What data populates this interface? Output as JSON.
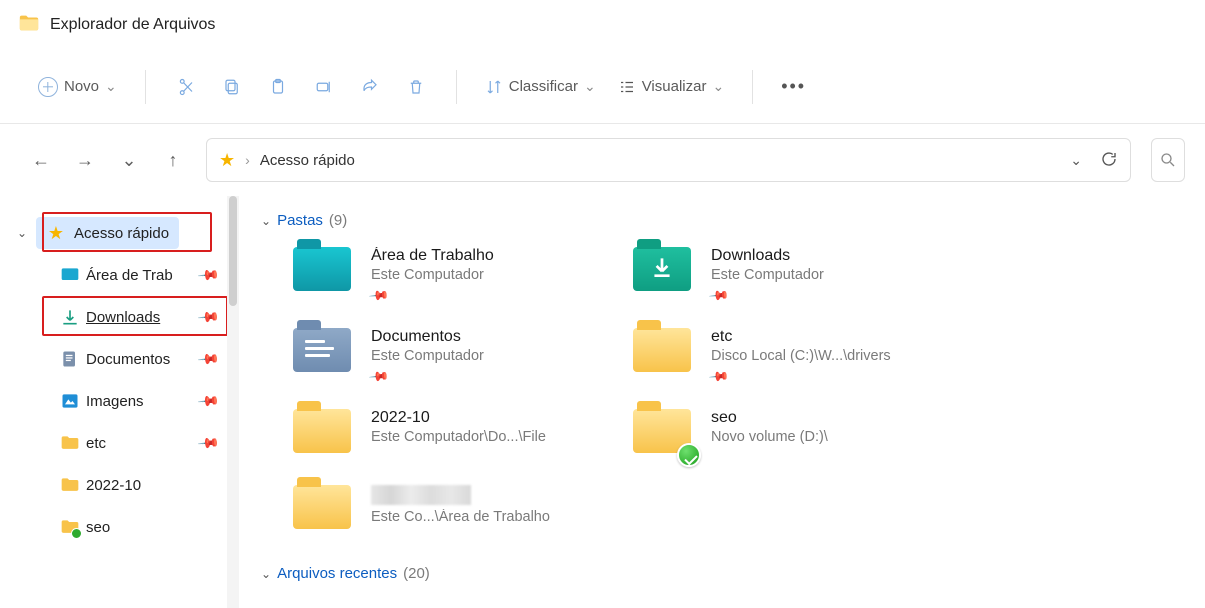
{
  "window": {
    "title": "Explorador de Arquivos"
  },
  "toolbar": {
    "new_label": "Novo",
    "sort_label": "Classificar",
    "view_label": "Visualizar"
  },
  "address": {
    "location": "Acesso rápido"
  },
  "sidebar": {
    "quick_access_label": "Acesso rápido",
    "items": [
      {
        "label": "Área de Trab"
      },
      {
        "label": "Downloads"
      },
      {
        "label": "Documentos"
      },
      {
        "label": "Imagens"
      },
      {
        "label": "etc"
      },
      {
        "label": "2022-10"
      },
      {
        "label": "seo"
      }
    ]
  },
  "groups": {
    "folders": {
      "label": "Pastas",
      "count_text": "(9)"
    },
    "recent": {
      "label": "Arquivos recentes",
      "count_text": "(20)"
    }
  },
  "tiles": [
    {
      "title": "Área de Trabalho",
      "subtitle": "Este Computador",
      "icon": "desktop",
      "pinned": true
    },
    {
      "title": "Downloads",
      "subtitle": "Este Computador",
      "icon": "downloads",
      "pinned": true
    },
    {
      "title": "Documentos",
      "subtitle": "Este Computador",
      "icon": "documents",
      "pinned": true
    },
    {
      "title": "etc",
      "subtitle": "Disco Local (C:)\\W...\\drivers",
      "icon": "folder",
      "pinned": true
    },
    {
      "title": "2022-10",
      "subtitle": "Este Computador\\Do...\\File",
      "icon": "folder",
      "pinned": false
    },
    {
      "title": "seo",
      "subtitle": "Novo volume (D:)\\",
      "icon": "folder-check",
      "pinned": false
    },
    {
      "title": "",
      "subtitle": "Este Co...\\Área de Trabalho",
      "icon": "folder",
      "pinned": false,
      "blurred": true
    }
  ]
}
